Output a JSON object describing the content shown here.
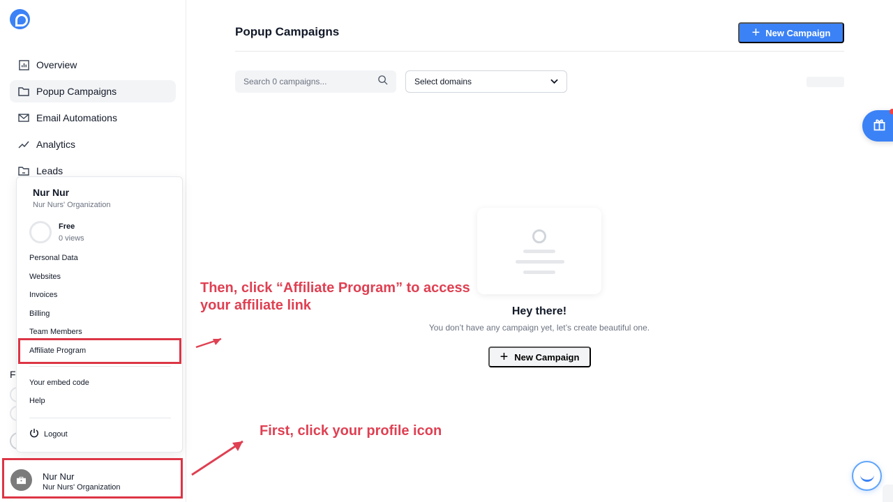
{
  "app": {
    "title": "Popup Campaigns"
  },
  "sidebar": {
    "items": [
      {
        "label": "Overview",
        "icon": "dashboard-icon"
      },
      {
        "label": "Popup Campaigns",
        "icon": "folder-icon"
      },
      {
        "label": "Email Automations",
        "icon": "mail-icon"
      },
      {
        "label": "Analytics",
        "icon": "analytics-icon"
      },
      {
        "label": "Leads",
        "icon": "leads-icon"
      }
    ],
    "partial_label": "F"
  },
  "header": {
    "new_campaign_label": "New Campaign"
  },
  "filters": {
    "search_placeholder": "Search 0 campaigns...",
    "domain_select": "Select domains"
  },
  "empty_state": {
    "title": "Hey there!",
    "message": "You don’t have any campaign yet, let’s create beautiful one.",
    "button_label": "New Campaign"
  },
  "profile_menu": {
    "name": "Nur Nur",
    "organization": "Nur Nurs' Organization",
    "plan": "Free",
    "views": "0 views",
    "items": [
      "Personal Data",
      "Websites",
      "Invoices",
      "Billing",
      "Team Members",
      "Affiliate Program",
      "Your embed code",
      "Help"
    ],
    "logout": "Logout"
  },
  "profile": {
    "name": "Nur Nur",
    "organization": "Nur Nurs' Organization"
  },
  "annotations": {
    "affiliate": [
      "Then, click “Affiliate Program” to access",
      "your affiliate link"
    ],
    "profile": "First, click your profile icon"
  },
  "colors": {
    "accent": "#3b82f6",
    "annotation": "#df4052",
    "highlight": "#dc3545"
  }
}
